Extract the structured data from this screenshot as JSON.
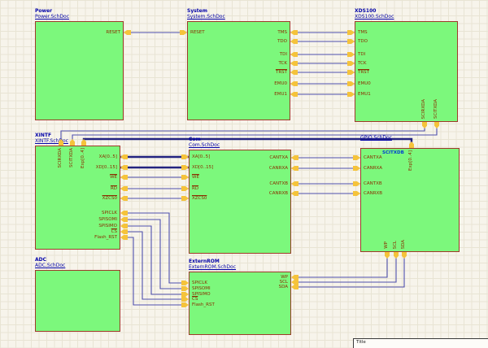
{
  "palette": {
    "sheet_bg": "#F7F4EB",
    "grid": "#E8E4D4",
    "symbol_fill": "#7CF87C",
    "symbol_border": "#9E3A2A",
    "pin_fill": "#F5C33B",
    "pin_text": "#8B2E00",
    "caption_text": "#0202A8",
    "wire": "#4F4FAD",
    "bus": "#23237F",
    "net_label": "#0040D0"
  },
  "blocks": {
    "power": {
      "name": "Power",
      "file": "Power.SchDoc",
      "pins": {
        "right": [
          {
            "label": "RESET"
          }
        ]
      }
    },
    "system": {
      "name": "System",
      "file": "System.SchDoc",
      "pins": {
        "left": [
          {
            "label": "RESET"
          }
        ],
        "right": [
          {
            "label": "TMS"
          },
          {
            "label": "TDO"
          },
          {
            "label": "TDI"
          },
          {
            "label": "TCK"
          },
          {
            "label": "TRST",
            "bar": true
          },
          {
            "label": "EMU0"
          },
          {
            "label": "EMU1"
          }
        ]
      }
    },
    "xds100": {
      "name": "XDS100",
      "file": "XDS100.SchDoc",
      "pins": {
        "left": [
          {
            "label": "TMS"
          },
          {
            "label": "TDO"
          },
          {
            "label": "TDI"
          },
          {
            "label": "TCK"
          },
          {
            "label": "TRST",
            "bar": true
          },
          {
            "label": "EMU0"
          },
          {
            "label": "EMU1"
          }
        ],
        "bottom": [
          {
            "label": "SCIRXDA"
          },
          {
            "label": "SCITXDA"
          }
        ]
      }
    },
    "xintf": {
      "name": "XINTF",
      "file": "XINTF.SchDoc",
      "pins": {
        "top": [
          {
            "label": "SCIRXDA"
          },
          {
            "label": "SCITXDA"
          },
          {
            "label": "Exp[0..4]"
          }
        ],
        "right": [
          {
            "label": "XA[0..5]"
          },
          {
            "label": "XD[0..15]"
          },
          {
            "label": "WE",
            "bar": true
          },
          {
            "label": "RD",
            "bar": true
          },
          {
            "label": "XZCS0",
            "bar": true
          },
          {
            "label": "SPICLK"
          },
          {
            "label": "SPISOMI"
          },
          {
            "label": "SPISIMO"
          },
          {
            "label": "CS",
            "bar": true
          },
          {
            "label": "Flash_RST"
          }
        ]
      }
    },
    "com": {
      "name": "Com",
      "file": "Com.SchDoc",
      "pins": {
        "left": [
          {
            "label": "XA[0..5]"
          },
          {
            "label": "XD[0..15]"
          },
          {
            "label": "WE",
            "bar": true
          },
          {
            "label": "RD",
            "bar": true
          },
          {
            "label": "XZCS0",
            "bar": true
          }
        ],
        "right": [
          {
            "label": "CANTXA"
          },
          {
            "label": "CANRXA"
          },
          {
            "label": "CANTXB"
          },
          {
            "label": "CANRXB"
          }
        ]
      }
    },
    "gpio": {
      "name": "",
      "file": "GPIO.SchDoc",
      "pins": {
        "left": [
          {
            "label": "CANTXA"
          },
          {
            "label": "CANRXA"
          },
          {
            "label": "CANTXB"
          },
          {
            "label": "CANRXB"
          }
        ],
        "top": [
          {
            "label": "Exp[0..4]"
          }
        ],
        "bottom": [
          {
            "label": "WP"
          },
          {
            "label": "SCL"
          },
          {
            "label": "SDA"
          }
        ]
      }
    },
    "adc": {
      "name": "ADC",
      "file": "ADC.SchDoc",
      "pins": {}
    },
    "externrom": {
      "name": "ExternROM",
      "file": "ExternROM.SchDoc",
      "pins": {
        "left": [
          {
            "label": "SPICLK"
          },
          {
            "label": "SPISOMI"
          },
          {
            "label": "SPISIMO"
          },
          {
            "label": "CS",
            "bar": true
          },
          {
            "label": "Flash_RST"
          }
        ],
        "right": [
          {
            "label": "WP"
          },
          {
            "label": "SCL"
          },
          {
            "label": "SDA"
          }
        ]
      }
    }
  },
  "net_labels": [
    {
      "text": "SCITXDB"
    }
  ],
  "title_block": {
    "label": "Title"
  }
}
